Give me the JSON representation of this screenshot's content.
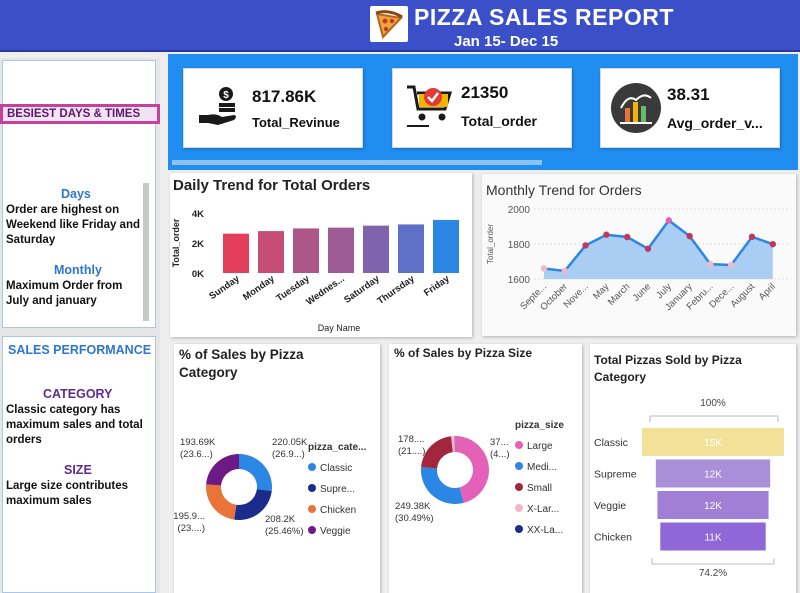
{
  "header": {
    "title": "PIZZA SALES REPORT",
    "subtitle": "Jan 15- Dec 15",
    "logo_icon": "pizza-icon"
  },
  "colors": {
    "header": "#3b4fc9",
    "kpi_band": "#1f8ef0",
    "accent_blue": "#2e76d1",
    "accent_purple": "#5c2d91",
    "highlight": "#c2429c"
  },
  "sidebar": {
    "busiest_title": "BESIEST DAYS & TIMES",
    "days_label": "Days",
    "days_text": "Order are highest on Weekend like Friday and Saturday",
    "monthly_label": "Monthly",
    "monthly_text": "Maximum Order from July and january",
    "sales_performance": "SALES PERFORMANCE",
    "category_label": "CATEGORY",
    "category_text": "Classic category has maximum sales and total orders",
    "size_label": "SIZE",
    "size_text": "Large size contributes maximum sales"
  },
  "kpis": [
    {
      "value": "817.86K",
      "label": "Total_Revinue",
      "icon": "money-hand-icon"
    },
    {
      "value": "21350",
      "label": "Total_order",
      "icon": "shopping-cart-icon"
    },
    {
      "value": "38.31",
      "label": "Avg_order_v...",
      "icon": "bar-chart-icon"
    }
  ],
  "chart_data": [
    {
      "type": "bar",
      "title": "Daily Trend for Total Orders",
      "xlabel": "Day Name",
      "ylabel": "Total_order",
      "categories": [
        "Sunday",
        "Monday",
        "Tuesday",
        "Wednes...",
        "Saturday",
        "Thursday",
        "Friday"
      ],
      "values": [
        2624,
        2794,
        2973,
        3024,
        3158,
        3239,
        3538
      ],
      "ylim": [
        0,
        4000
      ],
      "yticks": [
        "0K",
        "2K",
        "4K"
      ],
      "colors": [
        "#e33f5d",
        "#c64d76",
        "#ad5688",
        "#9d5b96",
        "#7f64ad",
        "#5f70c7",
        "#2b86e4"
      ]
    },
    {
      "type": "area",
      "title": "Monthly Trend for Orders",
      "ylabel": "Total_order",
      "categories": [
        "Septe...",
        "October",
        "Nove...",
        "May",
        "March",
        "June",
        "July",
        "January",
        "Febru...",
        "Dece...",
        "August",
        "April"
      ],
      "values": [
        1660,
        1646,
        1792,
        1853,
        1840,
        1773,
        1935,
        1845,
        1685,
        1680,
        1841,
        1799
      ],
      "ylim": [
        1600,
        2000
      ],
      "yticks": [
        "1600",
        "1800",
        "2000"
      ]
    },
    {
      "type": "pie",
      "title": "% of Sales by Pizza Category",
      "legend_title": "pizza_cate...",
      "labels": [
        "Classic",
        "Supre...",
        "Chicken",
        "Veggie"
      ],
      "values": [
        220.05,
        208.2,
        195.9,
        193.69
      ],
      "data_labels": [
        [
          "220.05K",
          "(26.9...)"
        ],
        [
          "208.2K",
          "(25.46%)"
        ],
        [
          "195.9...",
          "(23....)"
        ],
        [
          "193.69K",
          "(23.6...)"
        ]
      ],
      "colors": [
        "#2b86e4",
        "#1b2c8c",
        "#e8743a",
        "#6d1a86"
      ]
    },
    {
      "type": "pie",
      "title": "% of Sales by Pizza Size",
      "legend_title": "pizza_size",
      "labels": [
        "Large",
        "Medi...",
        "Small",
        "X-Lar...",
        "XX-La..."
      ],
      "values": [
        375.32,
        249.38,
        178.08,
        14.08,
        1.01
      ],
      "data_labels": [
        [
          "37...",
          "(4...)"
        ],
        [
          "249.38K",
          "(30.49%)"
        ],
        [
          "178....",
          "(21....)"
        ],
        [
          "",
          ""
        ],
        [
          "",
          ""
        ]
      ],
      "colors": [
        "#e461b8",
        "#2b86e4",
        "#a3263e",
        "#f0b8c8",
        "#1b2c8c"
      ]
    },
    {
      "type": "bar",
      "title": "Total Pizzas Sold by Pizza Category",
      "top_percent": "100%",
      "bottom_percent": "74.2%",
      "categories": [
        "Classic",
        "Supreme",
        "Veggie",
        "Chicken"
      ],
      "values": [
        14888,
        11987,
        11649,
        11050
      ],
      "data_labels": [
        "15K",
        "12K",
        "12K",
        "11K"
      ],
      "colors": [
        "#f2e199",
        "#a98fd8",
        "#a27fd6",
        "#8f67d8"
      ]
    }
  ]
}
